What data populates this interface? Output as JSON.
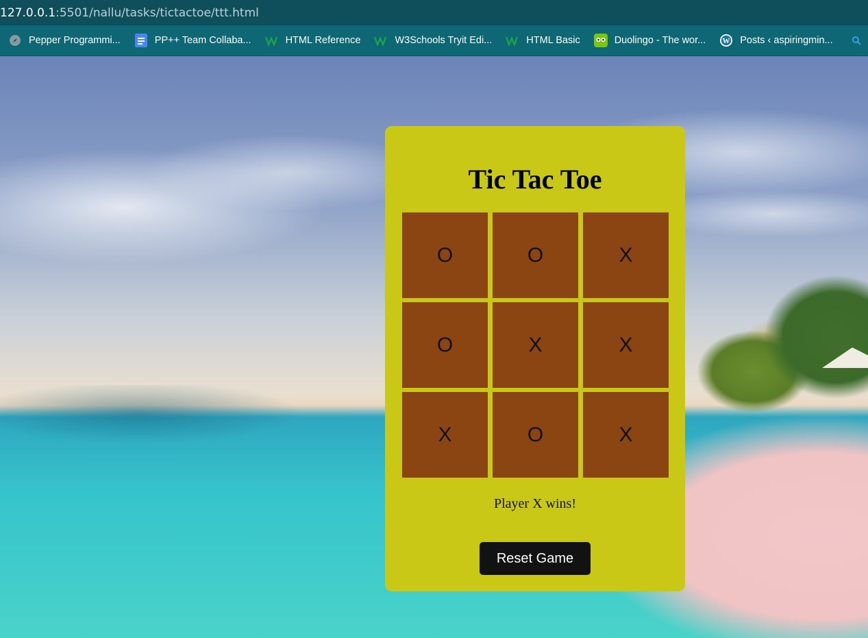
{
  "browser": {
    "url_host": "127.0.0.1",
    "url_path": ":5501/nallu/tasks/tictactoe/ttt.html",
    "bookmarks": [
      {
        "label": "Pepper Programmi...",
        "icon": "compass-icon"
      },
      {
        "label": "PP++ Team Collaba...",
        "icon": "google-docs-icon"
      },
      {
        "label": "HTML Reference",
        "icon": "w3schools-icon"
      },
      {
        "label": "W3Schools Tryit Edi...",
        "icon": "w3schools-icon"
      },
      {
        "label": "HTML Basic",
        "icon": "w3schools-icon"
      },
      {
        "label": "Duolingo - The wor...",
        "icon": "duolingo-icon"
      },
      {
        "label": "Posts ‹ aspiringmin...",
        "icon": "wordpress-icon"
      }
    ]
  },
  "game": {
    "title": "Tic Tac Toe",
    "board": [
      "O",
      "O",
      "X",
      "O",
      "X",
      "X",
      "X",
      "O",
      "X"
    ],
    "status": "Player X wins!",
    "reset_label": "Reset Game"
  },
  "colors": {
    "card": "#c9c816",
    "cell": "#8b4513",
    "button": "#121212"
  }
}
